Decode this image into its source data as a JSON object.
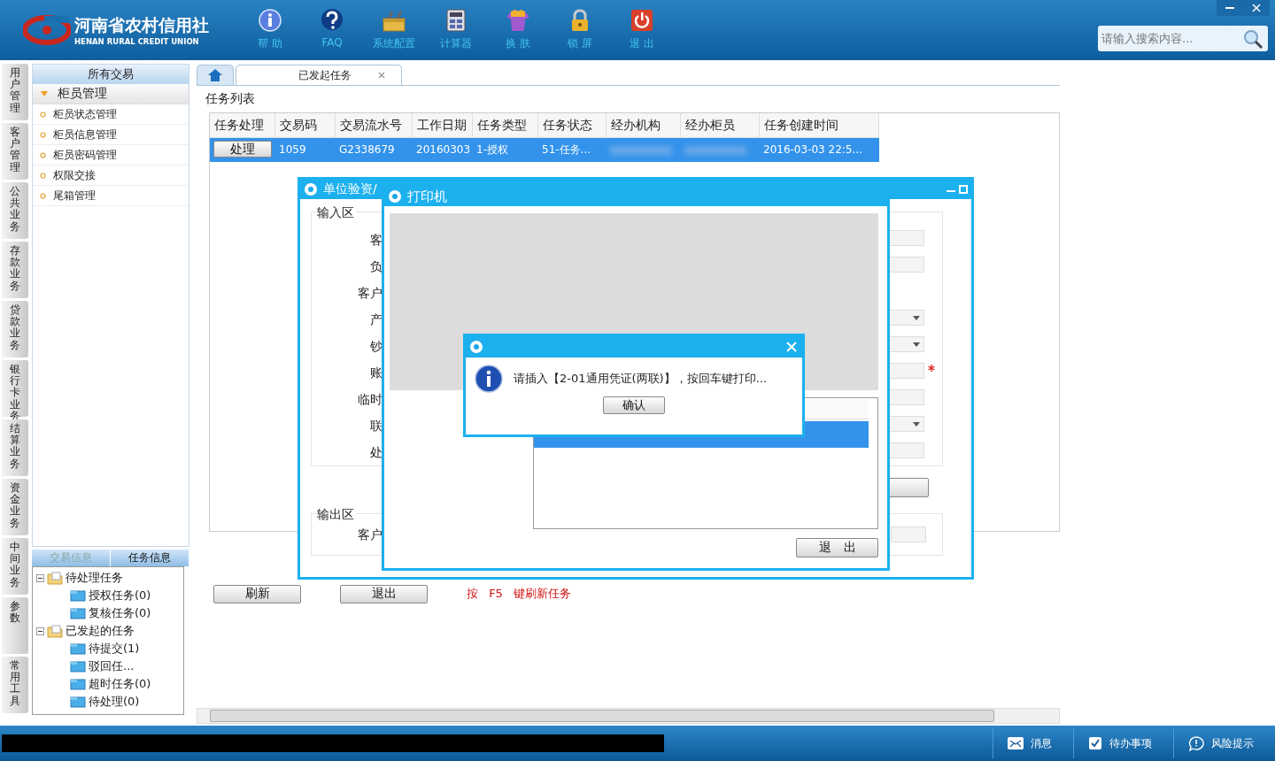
{
  "header": {
    "logo_cn": "河南省农村信用社",
    "logo_en": "HENAN RURAL CREDIT UNION",
    "tools": [
      {
        "label": "帮 助",
        "kind": "help"
      },
      {
        "label": "FAQ",
        "kind": "faq"
      },
      {
        "label": "系统配置",
        "kind": "settings"
      },
      {
        "label": "计算器",
        "kind": "calculator"
      },
      {
        "label": "换 肤",
        "kind": "skin"
      },
      {
        "label": "锁 屏",
        "kind": "lock"
      },
      {
        "label": "退 出",
        "kind": "exit"
      }
    ],
    "search": {
      "placeholder": "请输入搜索内容..."
    }
  },
  "side_tabs": [
    "用户管理",
    "客户管理",
    "公共业务",
    "存款业务",
    "贷款业务",
    "银行卡业务",
    "结算业务",
    "资金业务",
    "中间业务",
    "参数",
    "常用工具"
  ],
  "menu": {
    "title": "所有交易",
    "group": {
      "label": "柜员管理",
      "expanded": true
    },
    "items": [
      "柜员状态管理",
      "柜员信息管理",
      "柜员密码管理",
      "权限交接",
      "尾箱管理"
    ]
  },
  "info_tabs": [
    {
      "label": "交易信息",
      "selected": false
    },
    {
      "label": "任务信息",
      "selected": true
    }
  ],
  "tree": [
    {
      "label": "待处理任务",
      "expanded": true,
      "children": [
        {
          "label": "授权任务(0)"
        },
        {
          "label": "复核任务(0)"
        }
      ]
    },
    {
      "label": "已发起的任务",
      "expanded": true,
      "children": [
        {
          "label": "待提交(1)"
        },
        {
          "label": "驳回任..."
        },
        {
          "label": "超时任务(0)"
        },
        {
          "label": "待处理(0)"
        }
      ]
    }
  ],
  "tabs": [
    {
      "kind": "home",
      "selected": false
    },
    {
      "kind": "text",
      "label": "已发起任务",
      "selected": true
    }
  ],
  "task_list": {
    "title": "任务列表",
    "columns": [
      "任务处理",
      "交易码",
      "交易流水号",
      "工作日期",
      "任务类型",
      "任务状态",
      "经办机构",
      "经办柜员",
      "任务创建时间"
    ],
    "rows": [
      {
        "selected": true,
        "cells": [
          {
            "kind": "button",
            "text": "处理"
          },
          {
            "kind": "text",
            "text": "1059"
          },
          {
            "kind": "text",
            "text": "G2338679"
          },
          {
            "kind": "text",
            "text": "20160303"
          },
          {
            "kind": "text",
            "text": "1-授权"
          },
          {
            "kind": "text",
            "text": "51-任务..."
          },
          {
            "kind": "blurred"
          },
          {
            "kind": "blurred"
          },
          {
            "kind": "text",
            "text": "2016-03-03 22:5..."
          }
        ]
      }
    ]
  },
  "footer": {
    "buttons": [
      "刷新",
      "退出"
    ],
    "hint": "按 F5 键刷新任务"
  },
  "dialog": {
    "title": "单位验资/",
    "input_section": "输入区",
    "labels": [
      "客",
      "负",
      "客户",
      "产",
      "钞",
      "账",
      "临时",
      "联",
      "处"
    ],
    "fields": [
      {
        "kind": "field"
      },
      {
        "kind": "field"
      },
      {
        "kind": "none"
      },
      {
        "kind": "dropdown"
      },
      {
        "kind": "dropdown"
      },
      {
        "kind": "field",
        "required": true
      },
      {
        "kind": "field"
      },
      {
        "kind": "dropdown"
      },
      {
        "kind": "field"
      }
    ],
    "output_section": "输出区",
    "output_labels": [
      "客户"
    ]
  },
  "printer": {
    "title": "打印机",
    "jobs": [
      {
        "selected": true
      }
    ],
    "exit_button": "退　出"
  },
  "message": {
    "text": "请插入【2-01通用凭证(两联)】，按回车键打印...",
    "button": "确认"
  },
  "status_bar": {
    "items": [
      {
        "kind": "mail",
        "label": "消息"
      },
      {
        "kind": "check",
        "label": "待办事项"
      },
      {
        "kind": "chat",
        "label": "风险提示"
      }
    ]
  }
}
